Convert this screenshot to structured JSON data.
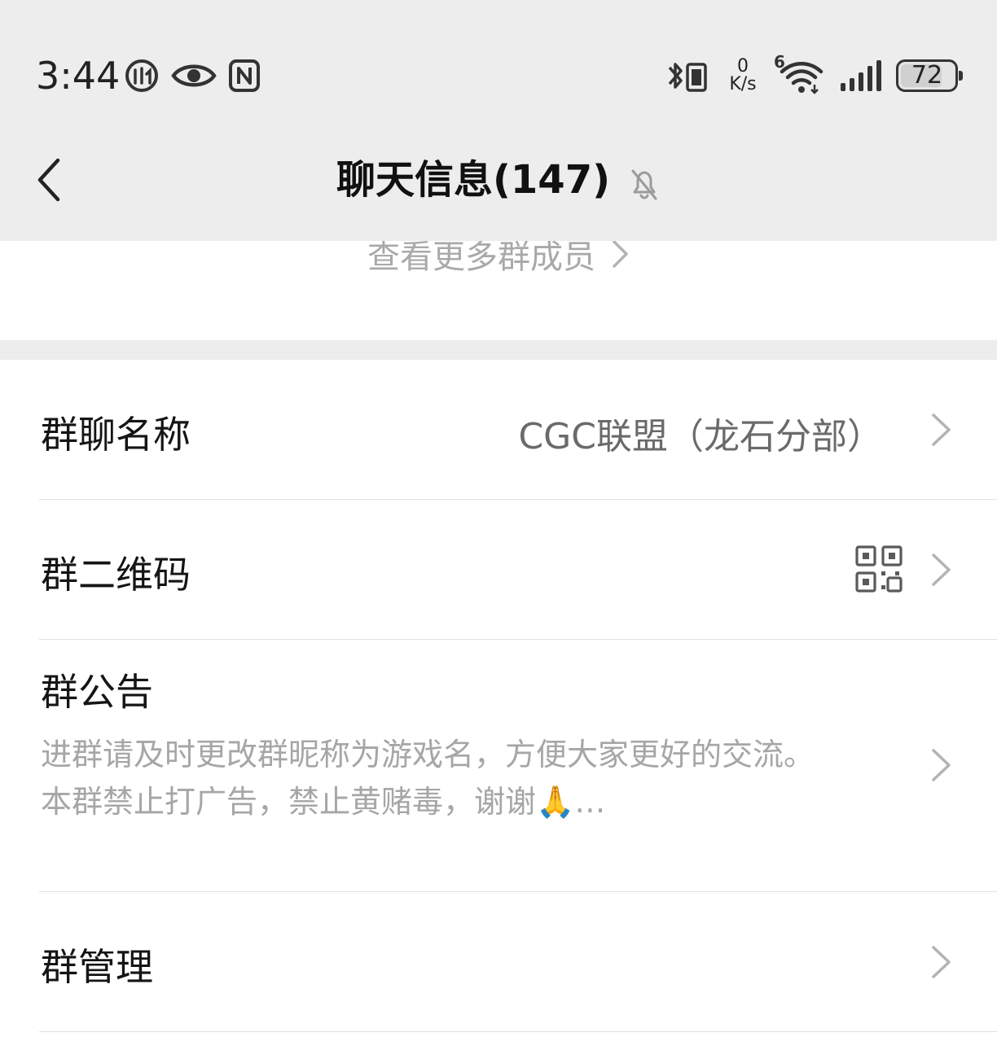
{
  "status_bar": {
    "time": "3:44",
    "net_speed_value": "0",
    "net_speed_unit": "K/s",
    "wifi_badge": "6",
    "battery_level": "72"
  },
  "nav": {
    "title": "聊天信息(147)",
    "back_icon": "chevron-left-icon",
    "mute_icon": "bell-off-icon"
  },
  "members": {
    "more_label": "查看更多群成员"
  },
  "settings": {
    "group_name": {
      "label": "群聊名称",
      "value": "CGC联盟（龙石分部）"
    },
    "qr_code": {
      "label": "群二维码",
      "icon": "qr-code-icon"
    },
    "notice": {
      "label": "群公告",
      "text": "进群请及时更改群昵称为游戏名，方便大家更好的交流。\n本群禁止打广告，禁止黄赌毒，谢谢🙏…"
    },
    "manage": {
      "label": "群管理"
    }
  },
  "colors": {
    "header_bg": "#ededed",
    "page_bg": "#ffffff",
    "muted_text": "#a6a6a6",
    "value_text": "#6a6a6a"
  }
}
